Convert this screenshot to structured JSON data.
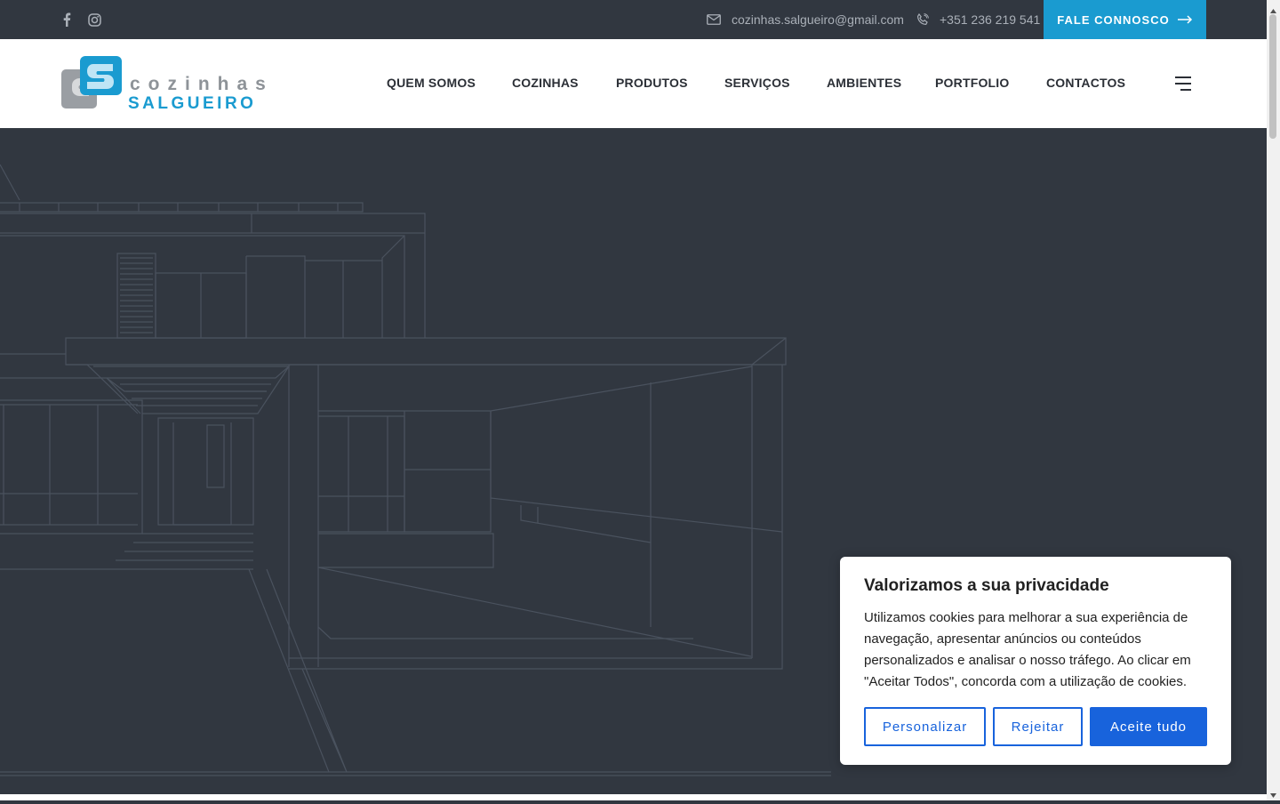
{
  "topbar": {
    "social": [
      {
        "name": "facebook-icon"
      },
      {
        "name": "instagram-icon"
      }
    ],
    "email": "cozinhas.salgueiro@gmail.com",
    "phone": "+351 236 219 541",
    "cta_label": "FALE CONNOSCO"
  },
  "logo": {
    "line1": "cozinhas",
    "line2": "SALGUEIRO",
    "mark": "CS"
  },
  "nav": {
    "items": [
      {
        "label": "QUEM SOMOS"
      },
      {
        "label": "COZINHAS"
      },
      {
        "label": "PRODUTOS"
      },
      {
        "label": "SERVIÇOS"
      },
      {
        "label": "AMBIENTES"
      },
      {
        "label": "PORTFOLIO"
      },
      {
        "label": "CONTACTOS"
      }
    ]
  },
  "cookie": {
    "title": "Valorizamos a sua privacidade",
    "text": "Utilizamos cookies para melhorar a sua experiência de navegação, apresentar anúncios ou conteúdos personalizados e analisar o nosso tráfego. Ao clicar em \"Aceitar Todos\", concorda com a utilização de cookies.",
    "customize_label": "Personalizar",
    "reject_label": "Rejeitar",
    "accept_label": "Aceite tudo"
  },
  "colors": {
    "dark_bg": "#313740",
    "accent": "#1a9bd0",
    "cookie_button": "#1863dc"
  }
}
